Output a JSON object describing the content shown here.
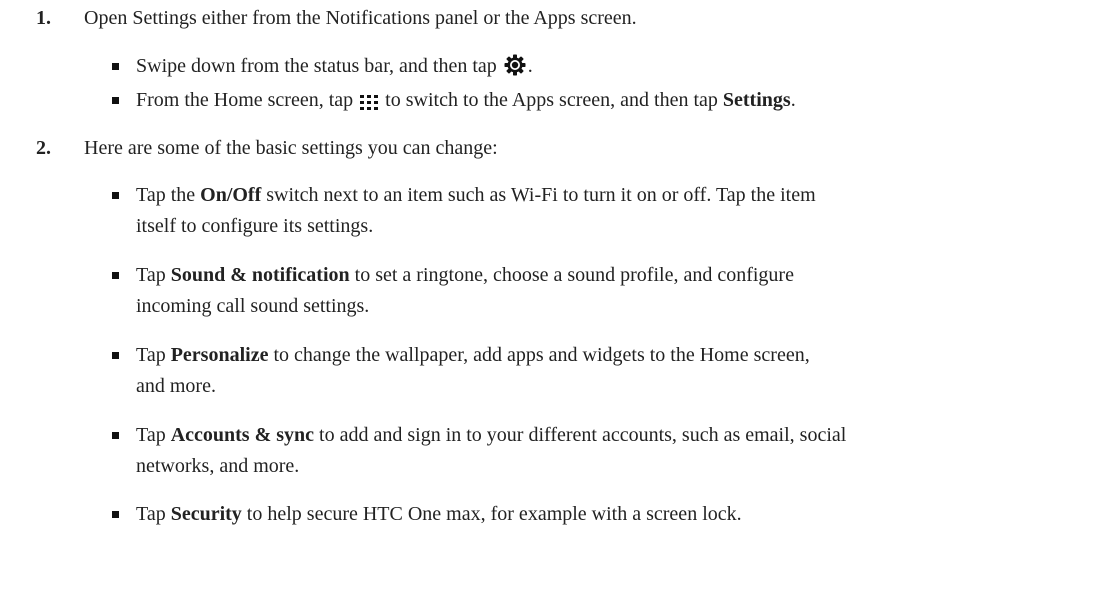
{
  "steps": [
    {
      "number": "1.",
      "text": "Open Settings either from the Notifications panel or the Apps screen.",
      "bullets": [
        {
          "before": "Swipe down from the status bar, and then tap",
          "icon": "settings-gear-icon",
          "after": "."
        },
        {
          "before": "From the Home screen, tap",
          "icon": "apps-grid-icon",
          "middle": " to switch to the Apps screen, and then tap ",
          "bold": "Settings",
          "after": "."
        }
      ]
    },
    {
      "number": "2.",
      "text": "Here are some of the basic settings you can change:",
      "bullets": [
        {
          "before": "Tap the ",
          "bold": "On/Off",
          "after_line1": " switch next to an item such as Wi-Fi to turn it on or off. Tap the item",
          "line2": "itself to configure its settings."
        },
        {
          "before": "Tap ",
          "bold": "Sound & notification",
          "after_line1": " to set a ringtone, choose a sound profile, and configure",
          "line2": "incoming call sound settings."
        },
        {
          "before": "Tap ",
          "bold": "Personalize",
          "after_line1": " to change the wallpaper, add apps and widgets to the Home screen,",
          "line2": "and more."
        },
        {
          "before": "Tap ",
          "bold": "Accounts & sync",
          "after_line1": " to add and sign in to your different accounts, such as email, social",
          "line2": "networks, and more."
        },
        {
          "before": "Tap ",
          "bold": "Security",
          "after_line1": " to help secure HTC One max, for example with a screen lock."
        }
      ]
    }
  ]
}
